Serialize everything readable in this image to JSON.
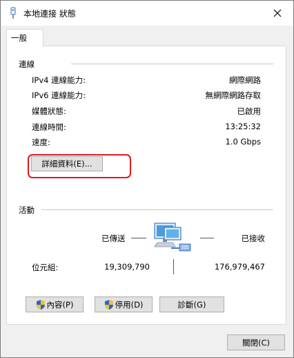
{
  "window": {
    "title": "本地連接 狀態",
    "close_glyph": "✕"
  },
  "tabs": [
    {
      "label": "一般"
    }
  ],
  "connection": {
    "header": "連線",
    "rows": [
      {
        "label": "IPv4 連線能力:",
        "value": "網際網路"
      },
      {
        "label": "IPv6 連線能力:",
        "value": "無網際網路存取"
      },
      {
        "label": "媒體狀態:",
        "value": "已啟用"
      },
      {
        "label": "連線時間:",
        "value": "13:25:32"
      },
      {
        "label": "速度:",
        "value": "1.0 Gbps"
      }
    ],
    "details_button": "詳細資料(E)..."
  },
  "activity": {
    "header": "活動",
    "sent_label": "已傳送",
    "received_label": "已接收",
    "bytes_label": "位元組:",
    "bytes_sent": "19,309,790",
    "bytes_received": "176,979,467"
  },
  "buttons": {
    "properties": "內容(P)",
    "disable": "停用(D)",
    "diagnose": "診斷(G)",
    "close": "關閉(C)"
  },
  "colors": {
    "highlight": "#e0161b",
    "shield_blue": "#2b64c6",
    "shield_yellow": "#f2c230"
  }
}
